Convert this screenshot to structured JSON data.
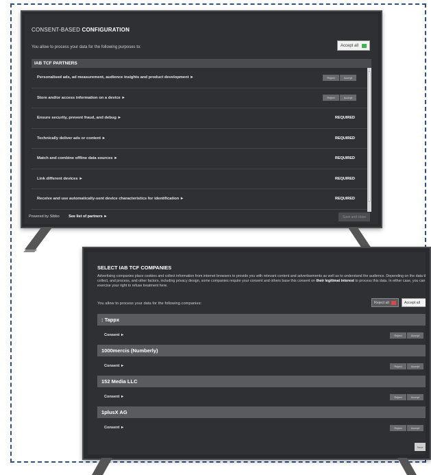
{
  "screen1": {
    "title_light": "CONSENT-BASED",
    "title_bold": "CONFIGURATION",
    "subtitle": "You allow to process your data for the following purposes to:",
    "accept_all": "Accept all",
    "list_header": "IAB TCF PARTNERS",
    "reject_label": "Reject",
    "accept_label": "Accept",
    "required_label": "REQUIRED",
    "purposes": [
      {
        "label": "Personalised ads, ad measurement, audience insights and product development ►",
        "required": false
      },
      {
        "label": "Store and/or access information on a device ►",
        "required": false
      },
      {
        "label": "Ensure security, prevent fraud, and debug ►",
        "required": true
      },
      {
        "label": "Technically deliver ads or content ►",
        "required": true
      },
      {
        "label": "Match and combine offline data sources ►",
        "required": true
      },
      {
        "label": "Link different devices ►",
        "required": true
      },
      {
        "label": "Receive and use automatically-sent device characteristics for identification ►",
        "required": true
      }
    ],
    "powered_by": "Powered by Sibbo",
    "see_partners": "See list of partners ►",
    "save_and_close": "Save and close"
  },
  "screen2": {
    "title": "SELECT IAB TCF COMPANIES",
    "description_part1": "Advertising companies place cookies and collect information from internet browsers to provide you with relevant content and advertisements as well as to understand the audience. Depending on the data they collect, and process, and other factors, including privacy design, some companies require your consent and others base this consent on",
    "description_bold": "their legitimat interest",
    "description_part2": "to process this data. In either case, you can exercise your right to refuse treatment here.",
    "subtitle": "You allow to process your data for the following companies:",
    "reject_all": "Reject all",
    "accept_all": "Accept all",
    "reject_label": "Reject",
    "accept_label": "Accept",
    "consent_label": "Consent ►",
    "companies": [
      {
        "name": ": Tappx"
      },
      {
        "name": "1000mercis (Numberly)"
      },
      {
        "name": "152 Media LLC"
      },
      {
        "name": "1plusX AG"
      }
    ],
    "next_button": "Save"
  },
  "colors": {
    "frame": "#2d4f86",
    "accept_green": "#3fb34f",
    "reject_red": "#d94848",
    "screen_bg": "#2f3034"
  }
}
